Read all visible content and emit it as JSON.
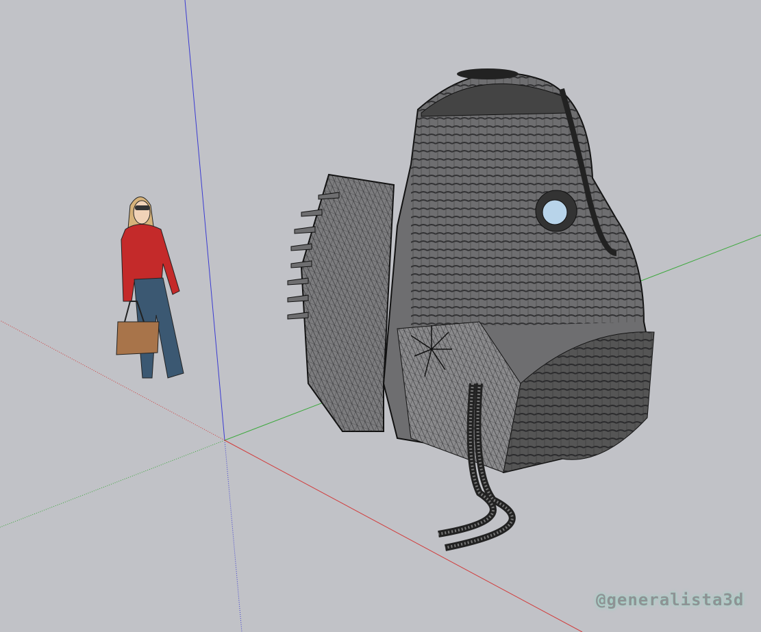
{
  "viewport": {
    "background": "#c1c2c7",
    "axes": {
      "red": "#d23a3a",
      "green": "#3aa83a",
      "blue": "#3a3ad2"
    },
    "model_color": "#6e6e70",
    "figure": {
      "shirt": "#c42a2a",
      "jeans": "#3b5872",
      "bag": "#a8744a",
      "hair": "#d6b27a"
    }
  },
  "watermark": "@generalista3d"
}
